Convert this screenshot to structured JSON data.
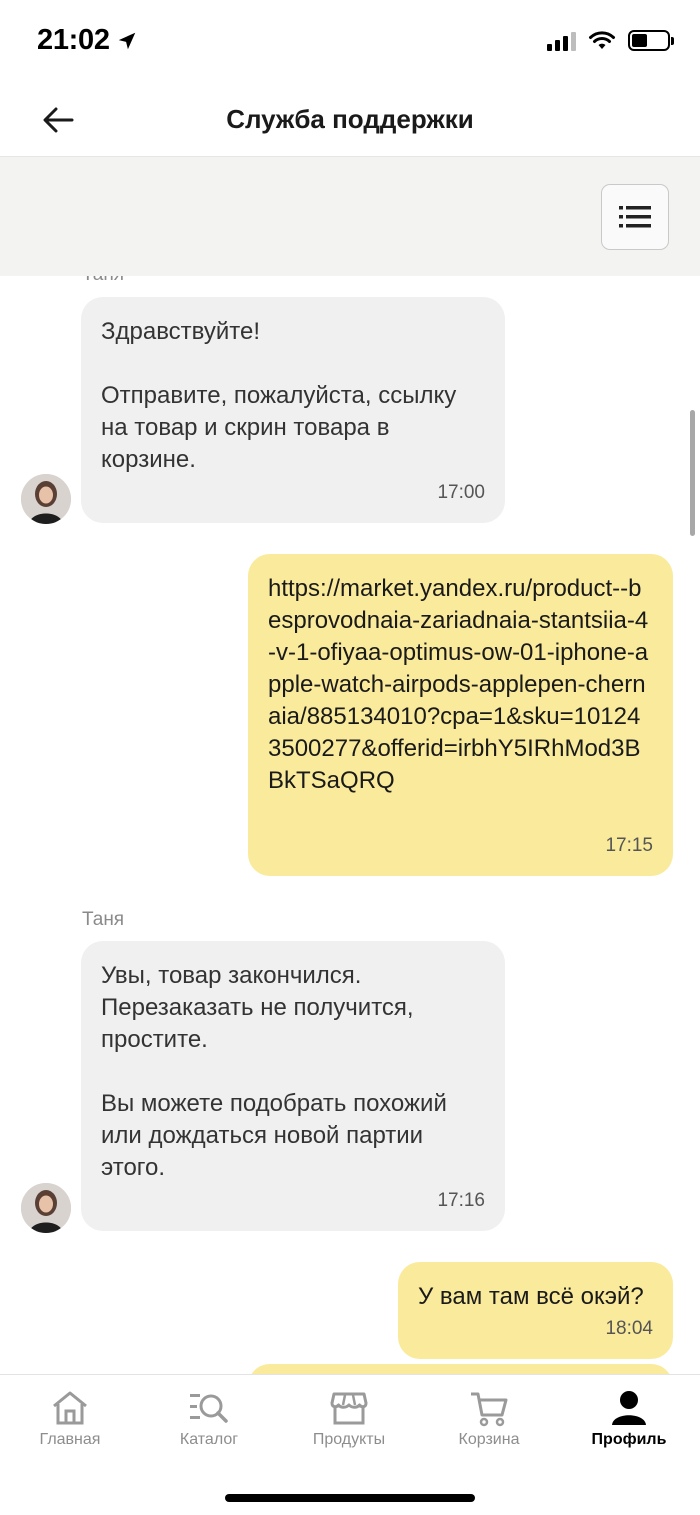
{
  "status_bar": {
    "time": "21:02"
  },
  "header": {
    "title": "Служба поддержки"
  },
  "chat": {
    "messages": [
      {
        "sender": "Таня",
        "text": "Здравствуйте!\n\nОтправите, пожалуйста, ссылку на товар и скрин товара в корзине.",
        "time": "17:00"
      },
      {
        "text": "https://market.yandex.ru/product--besprovodnaia-zariadnaia-stantsiia-4-v-1-ofiyaa-optimus-ow-01-iphone-apple-watch-airpods-applepen-chernaia/885134010?cpa=1&sku=101243500277&offerid=irbhY5IRhMod3BBkTSaQRQ",
        "time": "17:15"
      },
      {
        "sender": "Таня",
        "text": "Увы, товар закончился. Перезаказать не получится, простите.\n\nВы можете подобрать похожий или дождаться новой партии этого.",
        "time": "17:16"
      },
      {
        "text": "У вам там всё окэй?",
        "time": "18:04"
      }
    ]
  },
  "bottom_nav": {
    "items": [
      {
        "label": "Главная",
        "icon": "home-icon"
      },
      {
        "label": "Каталог",
        "icon": "catalog-search-icon"
      },
      {
        "label": "Продукты",
        "icon": "shop-icon"
      },
      {
        "label": "Корзина",
        "icon": "cart-icon"
      },
      {
        "label": "Профиль",
        "icon": "profile-icon",
        "active": true
      }
    ]
  },
  "colors": {
    "incoming_bubble": "#f0f0f0",
    "outgoing_bubble": "#faea9c",
    "toolbar": "#f3f3f1"
  }
}
